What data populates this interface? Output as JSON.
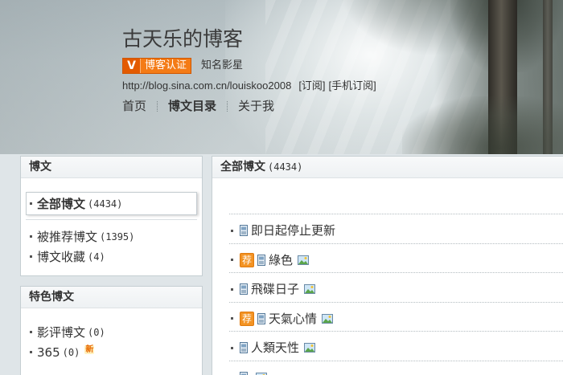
{
  "header": {
    "title": "古天乐的博客",
    "badge": {
      "mark": "V",
      "label": "博客认证"
    },
    "tagline": "知名影星",
    "url": "http://blog.sina.com.cn/louiskoo2008",
    "subscribe": "[订阅]",
    "mobile_subscribe": "[手机订阅]",
    "nav": [
      {
        "label": "首页",
        "active": false
      },
      {
        "label": "博文目录",
        "active": true
      },
      {
        "label": "关于我",
        "active": false
      }
    ]
  },
  "sidebar": {
    "articles": {
      "title": "博文",
      "items": [
        {
          "label": "全部博文",
          "count": "(4434)",
          "selected": true
        },
        {
          "label": "被推荐博文",
          "count": "(1395)",
          "selected": false
        },
        {
          "label": "博文收藏",
          "count": "(4)",
          "selected": false
        }
      ]
    },
    "featured": {
      "title": "特色博文",
      "items": [
        {
          "label": "影评博文",
          "count": "(0)"
        },
        {
          "label": "365",
          "count": "(0)",
          "badge": "新"
        }
      ]
    }
  },
  "main": {
    "title": "全部博文",
    "count": "(4434)",
    "recommend_label": "荐",
    "posts": [
      {
        "title": "即日起停止更新",
        "recommended": false,
        "has_image": false
      },
      {
        "title": "綠色",
        "recommended": true,
        "has_image": true
      },
      {
        "title": "飛碟日子",
        "recommended": false,
        "has_image": true
      },
      {
        "title": "天氣心情",
        "recommended": true,
        "has_image": true
      },
      {
        "title": "人類天性",
        "recommended": false,
        "has_image": true
      },
      {
        "title": "",
        "recommended": false,
        "has_image": true
      }
    ]
  },
  "icons": {
    "bullet": "bullet-icon",
    "post": "document-icon",
    "image": "image-icon",
    "verified": "verified-badge"
  },
  "colors": {
    "badge_orange": "#f47b16",
    "recommend_orange": "#f39323",
    "text": "#333333",
    "panel_border": "#c5ced2",
    "page_background": "#dfe5e8"
  }
}
